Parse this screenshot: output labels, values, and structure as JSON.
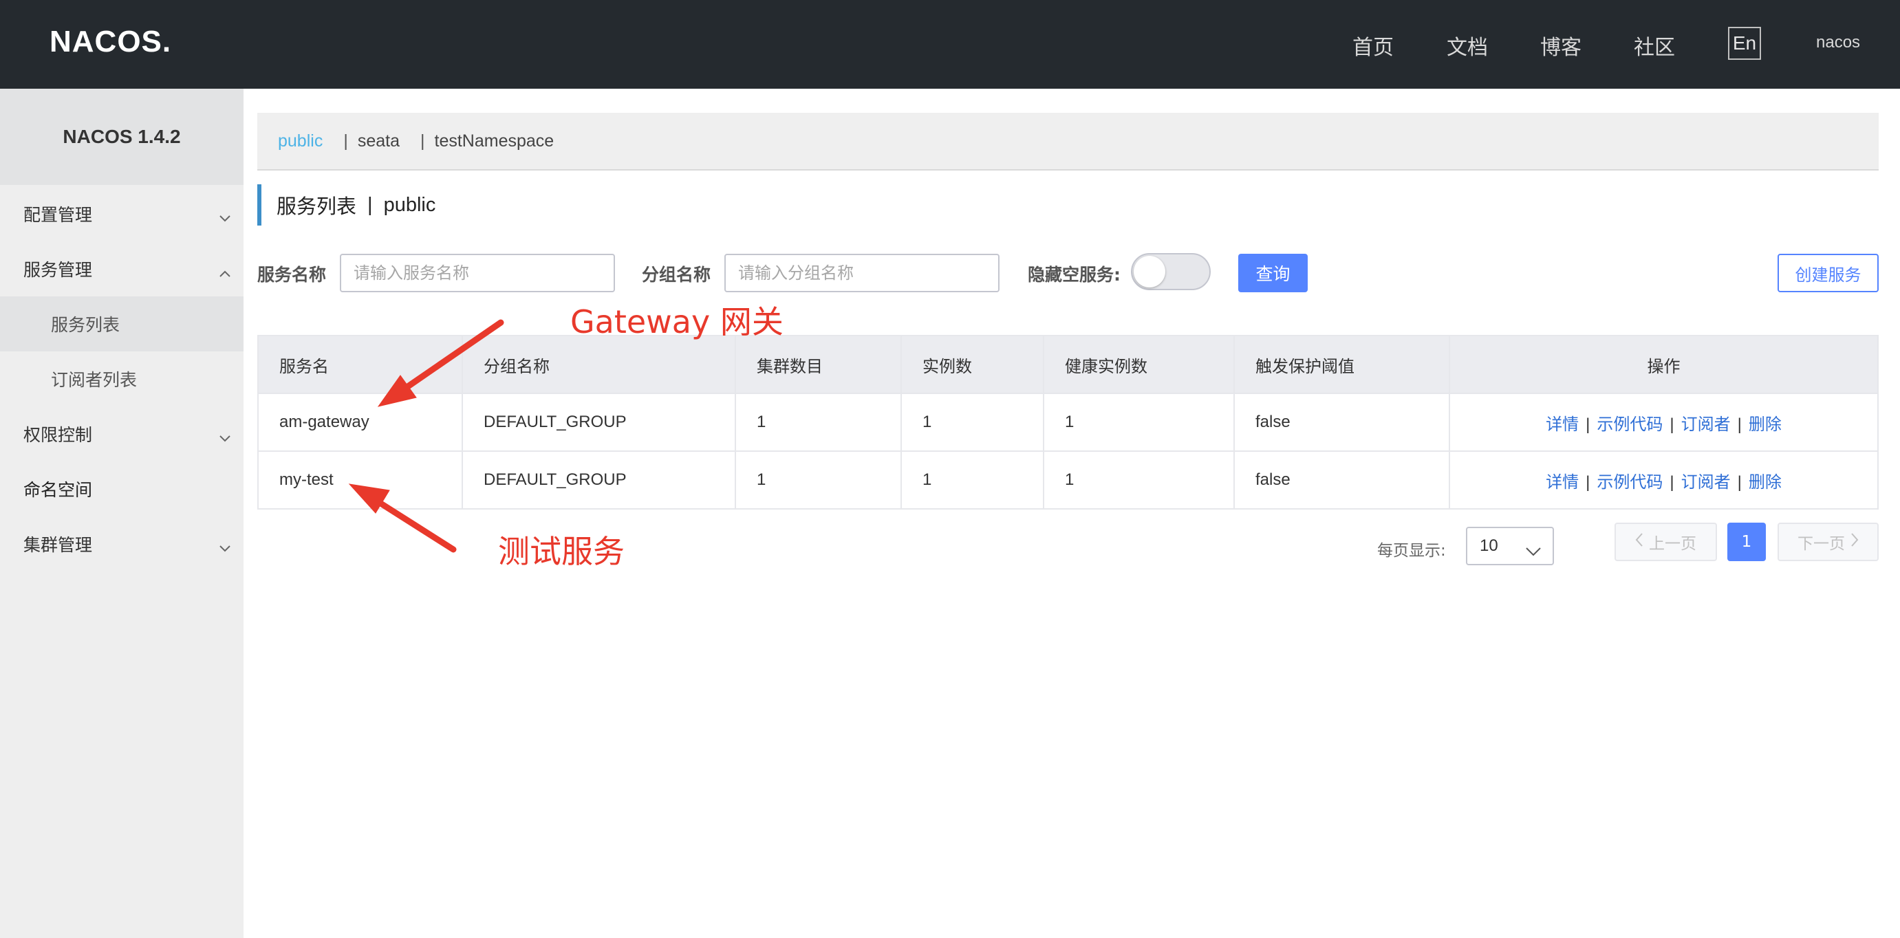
{
  "header": {
    "logo_text": "NACOS.",
    "nav": [
      "首页",
      "文档",
      "博客",
      "社区"
    ],
    "lang_button": "En",
    "user": "nacos"
  },
  "sidebar": {
    "title": "NACOS 1.4.2",
    "items": [
      {
        "label": "配置管理",
        "chevron": "down"
      },
      {
        "label": "服务管理",
        "chevron": "up"
      },
      {
        "label": "服务列表"
      },
      {
        "label": "订阅者列表"
      },
      {
        "label": "权限控制",
        "chevron": "down"
      },
      {
        "label": "命名空间"
      },
      {
        "label": "集群管理",
        "chevron": "down"
      }
    ]
  },
  "namespaces": {
    "items": [
      "public",
      "seata",
      "testNamespace"
    ],
    "separator": "|",
    "active": "public"
  },
  "page": {
    "title": "服务列表",
    "title_sep": "|",
    "namespace": "public"
  },
  "filters": {
    "service_label": "服务名称",
    "service_placeholder": "请输入服务名称",
    "group_label": "分组名称",
    "group_placeholder": "请输入分组名称",
    "hide_empty_label": "隐藏空服务:",
    "hide_empty_on": false,
    "query_button": "查询",
    "create_button": "创建服务"
  },
  "table": {
    "columns": [
      "服务名",
      "分组名称",
      "集群数目",
      "实例数",
      "健康实例数",
      "触发保护阈值",
      "操作"
    ],
    "rows": [
      {
        "name": "am-gateway",
        "group": "DEFAULT_GROUP",
        "clusters": "1",
        "instances": "1",
        "healthy": "1",
        "threshold": "false"
      },
      {
        "name": "my-test",
        "group": "DEFAULT_GROUP",
        "clusters": "1",
        "instances": "1",
        "healthy": "1",
        "threshold": "false"
      }
    ],
    "ops": [
      "详情",
      "示例代码",
      "订阅者",
      "删除"
    ],
    "op_sep": "|"
  },
  "pagination": {
    "page_size_label": "每页显示:",
    "page_size": "10",
    "prev": "上一页",
    "current": "1",
    "next": "下一页"
  },
  "annotations": {
    "gateway": "Gateway 网关",
    "test": "测试服务"
  },
  "colors": {
    "topbar": "#252a2f",
    "accent": "#5584ff",
    "link": "#2f6fd6",
    "annotation": "#e8392b",
    "ns_active": "#4db3e6"
  }
}
